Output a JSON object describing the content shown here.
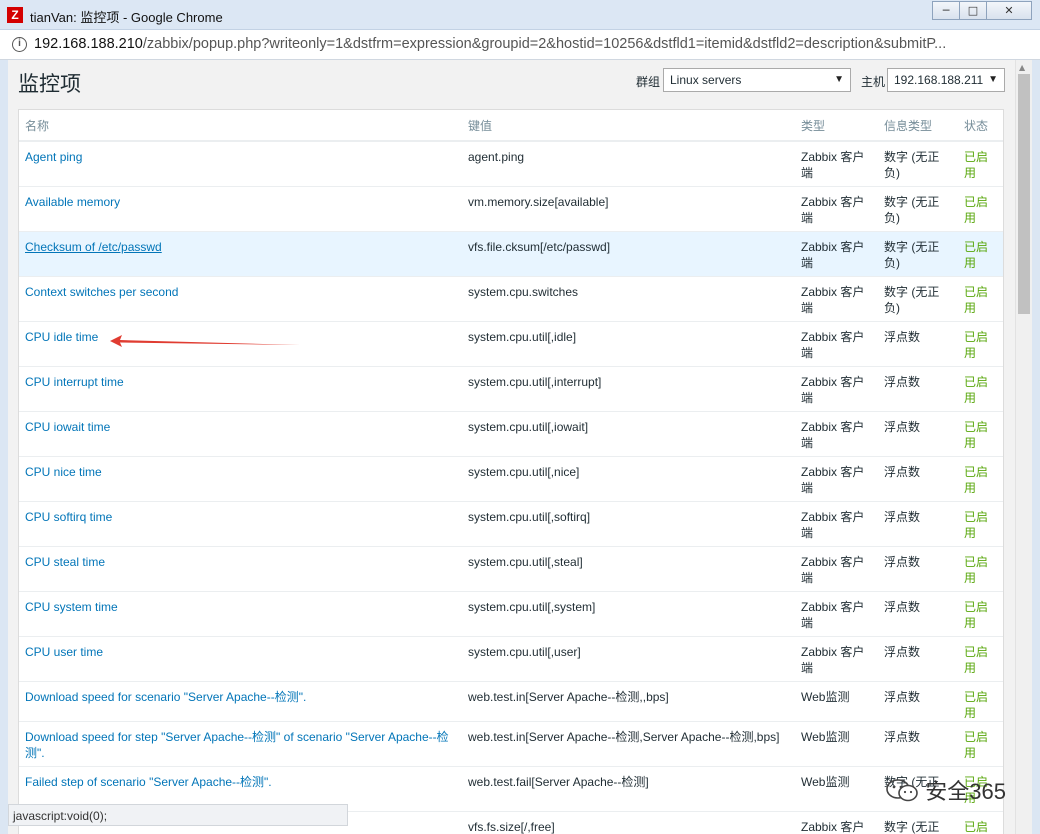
{
  "window": {
    "app_icon": "Z",
    "title": "tianVan: 监控项 - Google Chrome",
    "buttons": [
      "─",
      "□",
      "✕"
    ]
  },
  "address_bar": {
    "host": "192.168.188.210",
    "path": "/zabbix/popup.php?writeonly=1&dstfrm=expression&groupid=2&hostid=10256&dstfld1=itemid&dstfld2=description&submitP..."
  },
  "page": {
    "title": "监控项",
    "group_label": "群组",
    "group_value": "Linux servers",
    "host_label": "主机",
    "host_value": "192.168.188.211"
  },
  "table": {
    "headers": [
      "名称",
      "键值",
      "类型",
      "信息类型",
      "状态"
    ],
    "rows": [
      {
        "name": "Agent ping",
        "key": "agent.ping",
        "type": "Zabbix 客户端",
        "info": "数字 (无正负)",
        "status": "已启用"
      },
      {
        "name": "Available memory",
        "key": "vm.memory.size[available]",
        "type": "Zabbix 客户端",
        "info": "数字 (无正负)",
        "status": "已启用"
      },
      {
        "name": "Checksum of /etc/passwd",
        "key": "vfs.file.cksum[/etc/passwd]",
        "type": "Zabbix 客户端",
        "info": "数字 (无正负)",
        "status": "已启用"
      },
      {
        "name": "Context switches per second",
        "key": "system.cpu.switches",
        "type": "Zabbix 客户端",
        "info": "数字 (无正负)",
        "status": "已启用"
      },
      {
        "name": "CPU idle time",
        "key": "system.cpu.util[,idle]",
        "type": "Zabbix 客户端",
        "info": "浮点数",
        "status": "已启用"
      },
      {
        "name": "CPU interrupt time",
        "key": "system.cpu.util[,interrupt]",
        "type": "Zabbix 客户端",
        "info": "浮点数",
        "status": "已启用"
      },
      {
        "name": "CPU iowait time",
        "key": "system.cpu.util[,iowait]",
        "type": "Zabbix 客户端",
        "info": "浮点数",
        "status": "已启用"
      },
      {
        "name": "CPU nice time",
        "key": "system.cpu.util[,nice]",
        "type": "Zabbix 客户端",
        "info": "浮点数",
        "status": "已启用"
      },
      {
        "name": "CPU softirq time",
        "key": "system.cpu.util[,softirq]",
        "type": "Zabbix 客户端",
        "info": "浮点数",
        "status": "已启用"
      },
      {
        "name": "CPU steal time",
        "key": "system.cpu.util[,steal]",
        "type": "Zabbix 客户端",
        "info": "浮点数",
        "status": "已启用"
      },
      {
        "name": "CPU system time",
        "key": "system.cpu.util[,system]",
        "type": "Zabbix 客户端",
        "info": "浮点数",
        "status": "已启用"
      },
      {
        "name": "CPU user time",
        "key": "system.cpu.util[,user]",
        "type": "Zabbix 客户端",
        "info": "浮点数",
        "status": "已启用"
      },
      {
        "name": "Download speed for scenario \"Server Apache--检测\".",
        "key": "web.test.in[Server Apache--检测,,bps]",
        "type": "Web监测",
        "info": "浮点数",
        "status": "已启用"
      },
      {
        "name": "Download speed for step \"Server Apache--检测\" of scenario \"Server Apache--检测\".",
        "key": "web.test.in[Server Apache--检测,Server Apache--检测,bps]",
        "type": "Web监测",
        "info": "浮点数",
        "status": "已启用"
      },
      {
        "name": "Failed step of scenario \"Server Apache--检测\".",
        "key": "web.test.fail[Server Apache--检测]",
        "type": "Web监测",
        "info": "数字 (无正",
        "status": "已启用"
      },
      {
        "name": "",
        "key": "vfs.fs.size[/,free]",
        "type": "Zabbix 客户",
        "info": "数字 (无正",
        "status": "已启用"
      }
    ]
  },
  "status_bar": "javascript:void(0);",
  "watermark": "安全365",
  "colors": {
    "link": "#0275b8",
    "status_enabled": "#59a70c",
    "annotation_arrow": "#e03c31"
  }
}
